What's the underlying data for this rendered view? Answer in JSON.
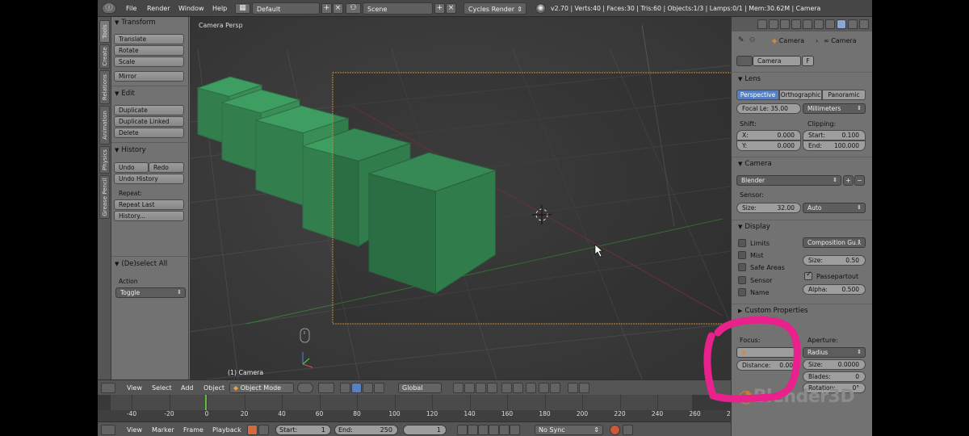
{
  "topbar": {
    "menus": [
      "File",
      "Render",
      "Window",
      "Help"
    ],
    "layout": "Default",
    "scene": "Scene",
    "engine": "Cycles Render",
    "stats": "v2.70 | Verts:40 | Faces:30 | Tris:60 | Objects:1/3 | Lamps:0/1 | Mem:30.62M | Camera"
  },
  "tool_tabs": [
    "Tools",
    "Create",
    "Relations",
    "Animation",
    "Physics",
    "Grease Pencil"
  ],
  "toolshelf": {
    "transform": {
      "title": "Transform",
      "buttons": [
        "Translate",
        "Rotate",
        "Scale",
        "Mirror"
      ]
    },
    "edit": {
      "title": "Edit",
      "buttons": [
        "Duplicate",
        "Duplicate Linked",
        "Delete"
      ]
    },
    "history": {
      "title": "History",
      "undo": "Undo",
      "redo": "Redo",
      "undo_history": "Undo History",
      "repeat_label": "Repeat:",
      "repeat_last": "Repeat Last",
      "history": "History..."
    },
    "operator": {
      "title": "(De)select All",
      "action_label": "Action",
      "action_value": "Toggle"
    }
  },
  "viewport": {
    "label": "Camera Persp",
    "object_label": "(1) Camera",
    "cube_color": "#3d9a5e",
    "frame_color": "#c98a3a"
  },
  "viewport_header": {
    "menus": [
      "View",
      "Select",
      "Add",
      "Object"
    ],
    "mode": "Object Mode",
    "orientation": "Global"
  },
  "timeline": {
    "ticks": [
      "-40",
      "-20",
      "0",
      "20",
      "40",
      "60",
      "80",
      "100",
      "120",
      "140",
      "160",
      "180",
      "200",
      "220",
      "240",
      "260",
      "280"
    ],
    "menus": [
      "View",
      "Marker",
      "Frame",
      "Playback"
    ],
    "start_label": "Start:",
    "start": "1",
    "end_label": "End:",
    "end": "250",
    "current": "1",
    "sync": "No Sync"
  },
  "properties": {
    "breadcrumb": [
      "Camera",
      "Camera"
    ],
    "datablock": "Camera",
    "datablock_f": "F",
    "lens": {
      "title": "Lens",
      "types": [
        "Perspective",
        "Orthographic",
        "Panoramic"
      ],
      "focal_label": "Focal Le:",
      "focal_value": "35.00",
      "units": "Millimeters",
      "shift_label": "Shift:",
      "shift_x_label": "X:",
      "shift_x": "0.000",
      "shift_y_label": "Y:",
      "shift_y": "0.000",
      "clipping_label": "Clipping:",
      "clip_start_label": "Start:",
      "clip_start": "0.100",
      "clip_end_label": "End:",
      "clip_end": "100.000"
    },
    "camera": {
      "title": "Camera",
      "preset": "Blender",
      "sensor_label": "Sensor:",
      "size_label": "Size:",
      "size_value": "32.00",
      "fit": "Auto"
    },
    "display": {
      "title": "Display",
      "checks": [
        "Limits",
        "Mist",
        "Safe Areas",
        "Sensor",
        "Name"
      ],
      "guides": "Composition Gu...",
      "size_label": "Size:",
      "size_value": "0.50",
      "passepartout": "Passepartout",
      "alpha_label": "Alpha:",
      "alpha_value": "0.500"
    },
    "custom": {
      "title": "Custom Properties"
    },
    "dof": {
      "focus_label": "Focus:",
      "distance_label": "Distance:",
      "distance_value": "0.00",
      "aperture_label": "Aperture:",
      "aperture_type": "Radius",
      "ap_size_label": "Size:",
      "ap_size_value": "0.0000",
      "blades_label": "Blades:",
      "blades_value": "0",
      "rotation_label": "Rotation:",
      "rotation_value": "0°"
    }
  },
  "watermark": "Blender3D",
  "annotation_color": "#e8218c"
}
